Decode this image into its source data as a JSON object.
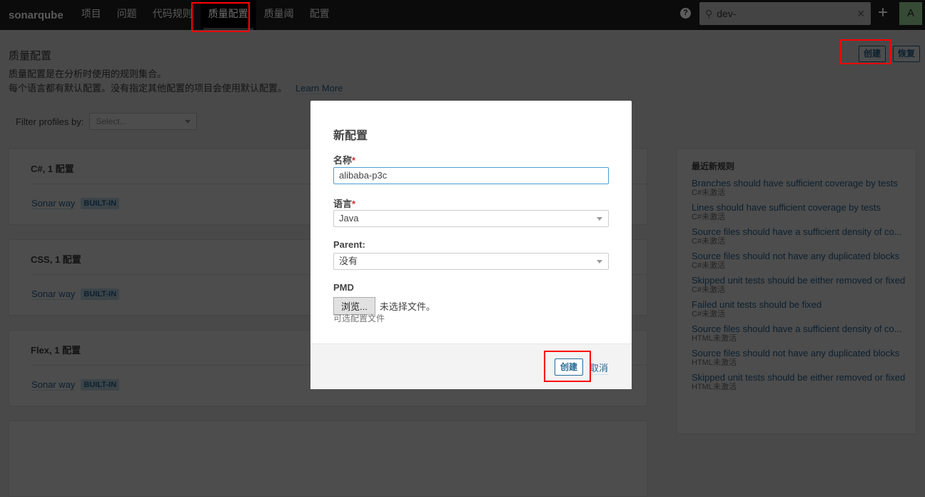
{
  "nav": {
    "logo": "sonarqube",
    "items": [
      "项目",
      "问题",
      "代码规则",
      "质量配置",
      "质量阈",
      "配置"
    ],
    "active": 3,
    "search_value": "dev-",
    "avatar": "A"
  },
  "page": {
    "title": "质量配置",
    "desc1": "质量配置是在分析时使用的规则集合。",
    "desc2": "每个语言都有默认配置。没有指定其他配置的项目会使用默认配置。",
    "learn_more": "Learn More",
    "create": "创建",
    "restore": "恢复",
    "filter_label": "Filter profiles by:",
    "filter_placeholder": "Select..."
  },
  "languages": [
    {
      "title": "C#, 1 配置",
      "profile": "Sonar way",
      "badge": "BUILT-IN"
    },
    {
      "title": "CSS, 1 配置",
      "profile": "Sonar way",
      "badge": "BUILT-IN"
    },
    {
      "title": "Flex, 1 配置",
      "profile": "Sonar way",
      "badge": "BUILT-IN"
    }
  ],
  "sidebar": {
    "title": "最近新规则",
    "rules": [
      {
        "name": "Branches should have sufficient coverage by tests",
        "meta": "C#未激活"
      },
      {
        "name": "Lines should have sufficient coverage by tests",
        "meta": "C#未激活"
      },
      {
        "name": "Source files should have a sufficient density of co...",
        "meta": "C#未激活"
      },
      {
        "name": "Source files should not have any duplicated blocks",
        "meta": "C#未激活"
      },
      {
        "name": "Skipped unit tests should be either removed or fixed",
        "meta": "C#未激活"
      },
      {
        "name": "Failed unit tests should be fixed",
        "meta": "C#未激活"
      },
      {
        "name": "Source files should have a sufficient density of co...",
        "meta": "HTML未激活"
      },
      {
        "name": "Source files should not have any duplicated blocks",
        "meta": "HTML未激活"
      },
      {
        "name": "Skipped unit tests should be either removed or fixed",
        "meta": "HTML未激活"
      }
    ]
  },
  "modal": {
    "title": "新配置",
    "name_label": "名称",
    "name_value": "alibaba-p3c",
    "lang_label": "语言",
    "lang_value": "Java",
    "parent_label": "Parent:",
    "parent_value": "没有",
    "pmd_label": "PMD",
    "browse": "浏览...",
    "no_file": "未选择文件。",
    "hint": "可选配置文件",
    "create": "创建",
    "cancel": "取消",
    "required": "*"
  },
  "colors": {
    "highlight": "#ff0000",
    "link": "#236a97"
  }
}
